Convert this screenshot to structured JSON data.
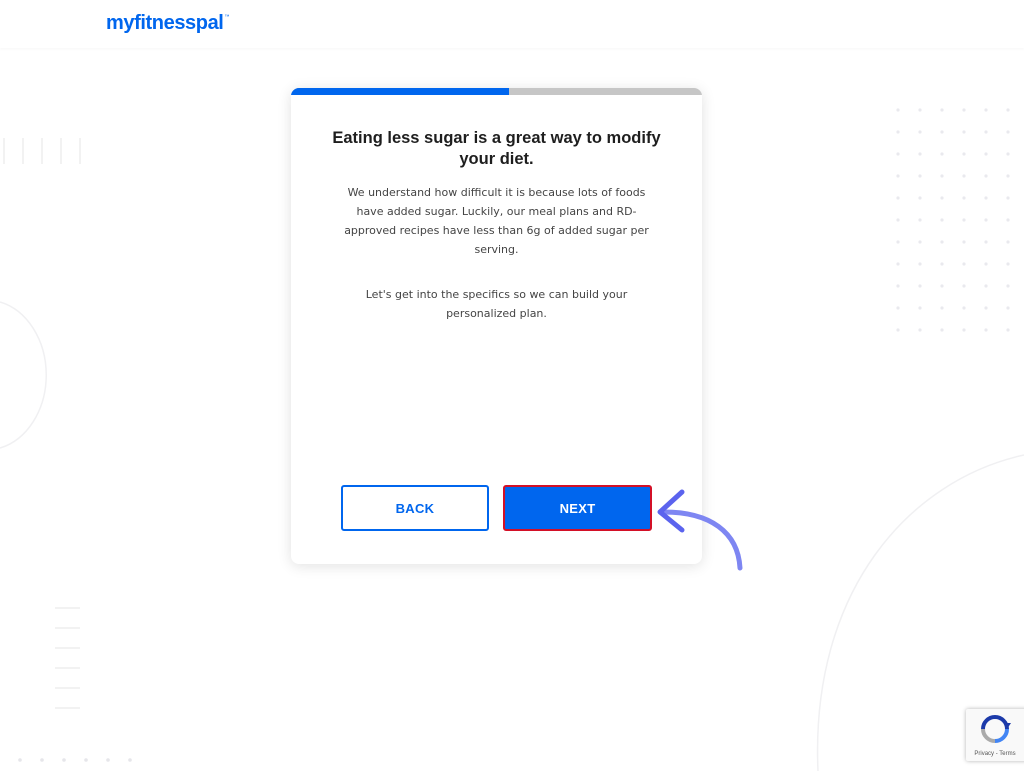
{
  "header": {
    "logo_text": "myfitnesspal",
    "logo_tm": "™"
  },
  "colors": {
    "brand": "#0066ee",
    "progress_track": "#c6c6c6",
    "highlight": "#d31027",
    "arrow": "#7e86f2"
  },
  "card": {
    "progress": 0.53,
    "title": "Eating less sugar is a great way to modify your diet.",
    "paragraphs": [
      "We understand how difficult it is because lots of foods have added sugar. Luckily, our meal plans and RD-approved recipes have less than 6g of added sugar per serving.",
      "Let's get into the specifics so we can build your personalized plan."
    ],
    "back_label": "BACK",
    "next_label": "NEXT"
  },
  "recaptcha": {
    "icon": "recaptcha-icon",
    "links": "Privacy - Terms"
  },
  "annotation": {
    "icon": "curved-arrow-icon"
  }
}
